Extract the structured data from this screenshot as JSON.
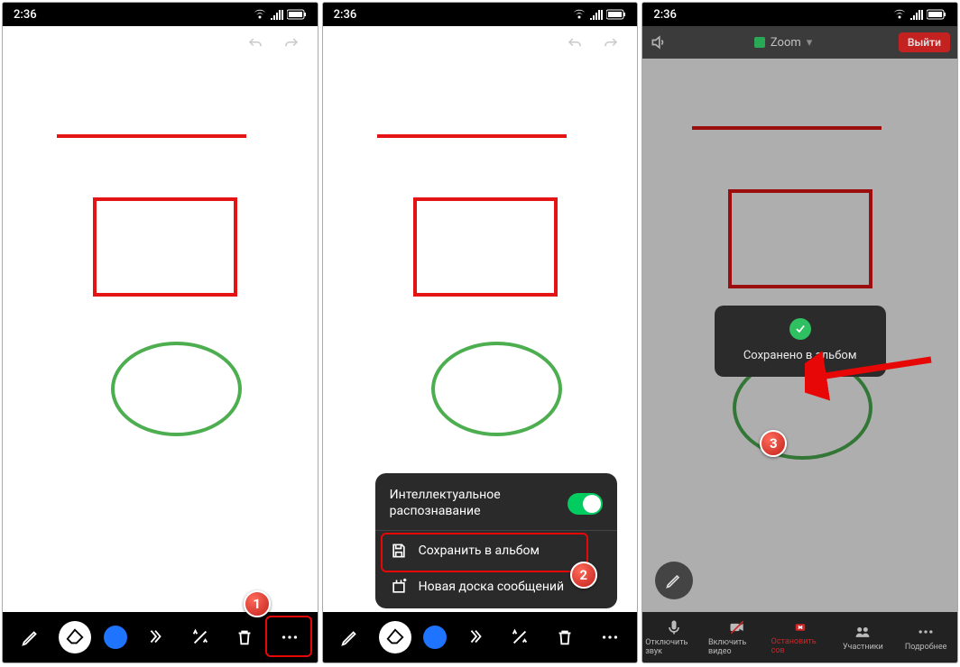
{
  "status": {
    "time": "2:36"
  },
  "phone1": {
    "step_number": "1"
  },
  "phone2": {
    "popup": {
      "toggle_label": "Интеллектуальное распознавание",
      "save_label": "Сохранить в альбом",
      "new_board_label": "Новая доска сообщений"
    },
    "step_number": "2"
  },
  "phone3": {
    "topbar": {
      "title": "Zoom",
      "exit": "Выйти"
    },
    "toast": {
      "text": "Сохранено в альбом"
    },
    "bottombar": {
      "mute": "Отключить звук",
      "video": "Включить видео",
      "share": "Остановить сов",
      "participants": "Участники",
      "more": "Подробнее"
    },
    "step_number": "3"
  }
}
